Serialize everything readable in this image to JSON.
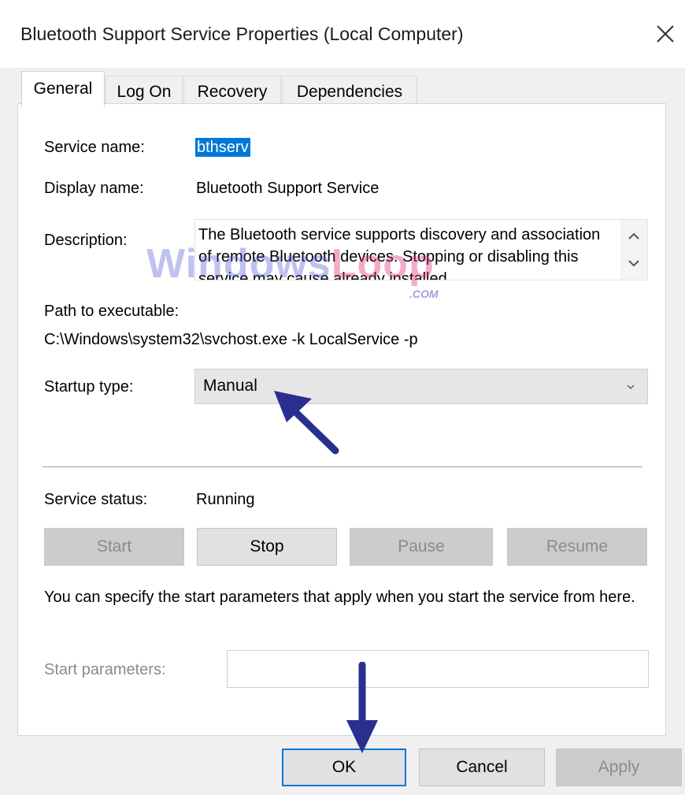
{
  "window": {
    "title": "Bluetooth Support Service Properties (Local Computer)"
  },
  "tabs": [
    {
      "label": "General",
      "active": true
    },
    {
      "label": "Log On",
      "active": false
    },
    {
      "label": "Recovery",
      "active": false
    },
    {
      "label": "Dependencies",
      "active": false
    }
  ],
  "general": {
    "service_name_label": "Service name:",
    "service_name_value": "bthserv",
    "display_name_label": "Display name:",
    "display_name_value": "Bluetooth Support Service",
    "description_label": "Description:",
    "description_value": "The Bluetooth service supports discovery and association of remote Bluetooth devices.  Stopping or disabling this service may cause already installed",
    "path_label": "Path to executable:",
    "path_value": "C:\\Windows\\system32\\svchost.exe -k LocalService -p",
    "startup_type_label": "Startup type:",
    "startup_type_value": "Manual",
    "service_status_label": "Service status:",
    "service_status_value": "Running",
    "buttons": {
      "start": "Start",
      "stop": "Stop",
      "pause": "Pause",
      "resume": "Resume"
    },
    "start_params_hint": "You can specify the start parameters that apply when you start the service from here.",
    "start_params_label": "Start parameters:",
    "start_params_value": ""
  },
  "footer": {
    "ok_label": "OK",
    "cancel_label": "Cancel",
    "apply_label": "Apply"
  },
  "watermark": {
    "text_main": "Windows",
    "text_accent": "Loop",
    "text_suffix": ".COM"
  },
  "colors": {
    "selection": "#0078d7",
    "annotation_arrow": "#2a2f8f",
    "disabled_button": "#cccccc",
    "window_bg": "#f0f0f0"
  }
}
